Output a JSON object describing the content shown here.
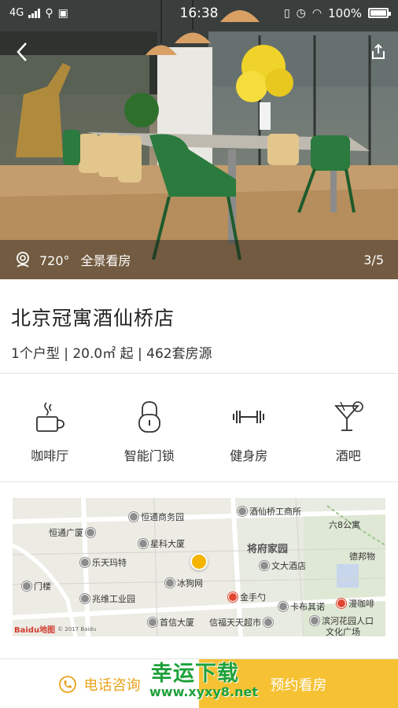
{
  "status_bar": {
    "network": "4G",
    "time": "16:38",
    "battery": "100%"
  },
  "hero": {
    "vr_degree": "720°",
    "vr_label": "全景看房",
    "photo_counter": "3/5"
  },
  "property": {
    "title": "北京冠寓酒仙桥店",
    "meta": "1个户型 | 20.0㎡ 起 | 462套房源"
  },
  "amenities": [
    {
      "label": "咖啡厅",
      "icon": "coffee-cup-icon"
    },
    {
      "label": "智能门锁",
      "icon": "padlock-icon"
    },
    {
      "label": "健身房",
      "icon": "dumbbell-icon"
    },
    {
      "label": "酒吧",
      "icon": "cocktail-glass-icon"
    }
  ],
  "map": {
    "labels": [
      "恒通商务园",
      "酒仙桥工商所",
      "六8公寓",
      "恒通广厦",
      "星科大厦",
      "将府家园",
      "文大酒店",
      "德邦物",
      "乐天玛特",
      "冰狗网",
      "门楼",
      "兆维工业园",
      "金手勺",
      "卡布其诺",
      "漫咖啡",
      "首信大厦",
      "信福天天超市",
      "滨河花园人口",
      "文化广场"
    ],
    "logo": "Baidu地图",
    "copyright": "© 2017 Baidu"
  },
  "actions": {
    "call_label": "电话咨询",
    "book_label": "预约看房"
  },
  "watermark": {
    "title": "幸运下载",
    "url": "www.xyxy8.net"
  },
  "colors": {
    "accent": "#f6c234",
    "call_text": "#e8a31c",
    "watermark": "#1ea13a",
    "map_pin": "#f4b400"
  }
}
